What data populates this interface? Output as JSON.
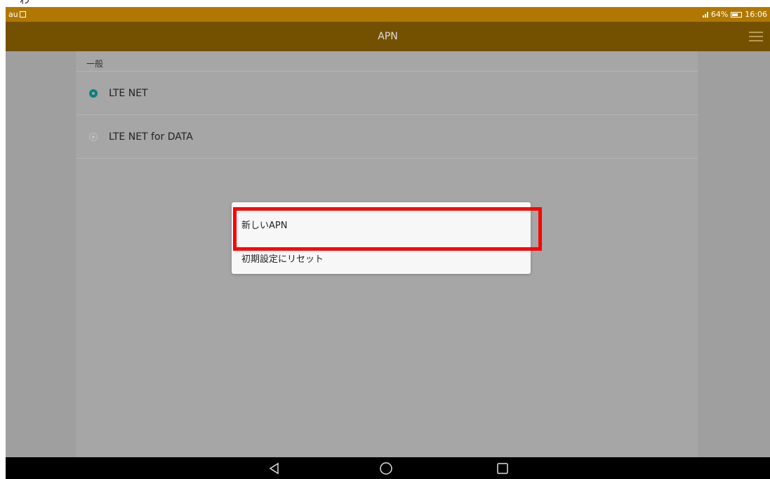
{
  "stray_text": "わ",
  "status_bar": {
    "carrier": "au",
    "sim_icon": "sim-card-icon",
    "battery_percent": "64%",
    "time": "16:06"
  },
  "app_bar": {
    "title": "APN",
    "menu_icon": "hamburger-menu-icon"
  },
  "section": {
    "header": "一般",
    "items": [
      {
        "label": "LTE NET",
        "selected": true
      },
      {
        "label": "LTE NET for DATA",
        "selected": false
      }
    ]
  },
  "popup_menu": {
    "items": [
      {
        "label": "新しいAPN",
        "highlighted": true
      },
      {
        "label": "初期設定にリセット",
        "highlighted": false
      }
    ]
  },
  "nav_bar": {
    "back": "back-triangle-icon",
    "home": "home-circle-icon",
    "recent": "recent-apps-square-icon"
  },
  "colors": {
    "status_bar": "#b07800",
    "app_bar": "#745100",
    "radio_accent": "#0d8080",
    "highlight": "#ff0000"
  }
}
